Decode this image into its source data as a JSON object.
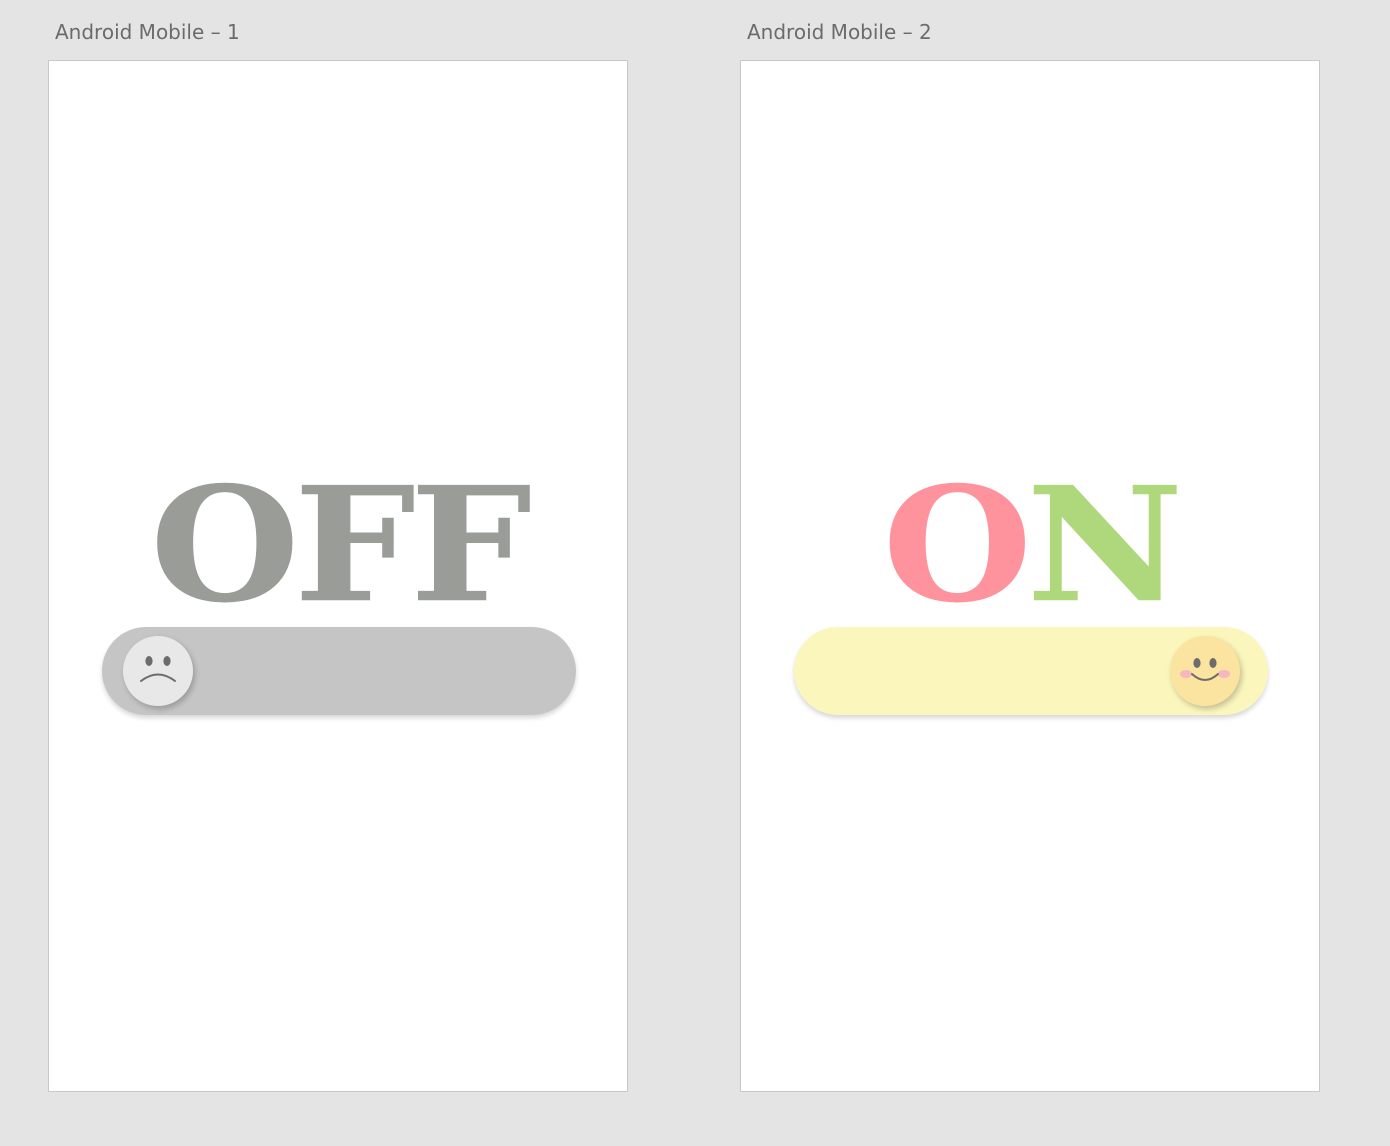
{
  "artboards": [
    {
      "title": "Android Mobile – 1",
      "letters": [
        "O",
        "F",
        "F"
      ],
      "letter_colors": [
        "#9a9c97",
        "#9a9c97",
        "#9a9c97"
      ],
      "toggle_state": "off",
      "track_color": "#c5c5c5",
      "knob_color": "#e8e8e8",
      "knob_icon": "sad-face-icon"
    },
    {
      "title": "Android Mobile – 2",
      "letters": [
        "O",
        "N"
      ],
      "letter_colors": [
        "#ff939d",
        "#aed87b"
      ],
      "toggle_state": "on",
      "track_color": "#fbf6bc",
      "knob_color": "#fbe4a0",
      "knob_icon": "happy-face-icon"
    }
  ]
}
